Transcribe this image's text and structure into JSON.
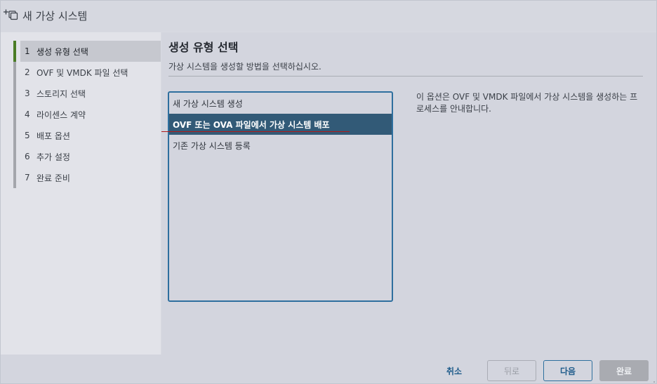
{
  "window": {
    "title": "새 가상 시스템",
    "icon": "new-vm-icon"
  },
  "nav": {
    "items": [
      {
        "num": "1",
        "label": "생성 유형 선택",
        "active": true
      },
      {
        "num": "2",
        "label": "OVF 및 VMDK 파일 선택",
        "active": false
      },
      {
        "num": "3",
        "label": "스토리지 선택",
        "active": false
      },
      {
        "num": "4",
        "label": "라이센스 계약",
        "active": false
      },
      {
        "num": "5",
        "label": "배포 옵션",
        "active": false
      },
      {
        "num": "6",
        "label": "추가 설정",
        "active": false
      },
      {
        "num": "7",
        "label": "완료 준비",
        "active": false
      }
    ]
  },
  "main": {
    "title": "생성 유형 선택",
    "subtitle": "가상 시스템을 생성할 방법을 선택하십시오.",
    "options": [
      {
        "label": "새 가상 시스템 생성",
        "selected": false
      },
      {
        "label": "OVF 또는 OVA 파일에서 가상 시스템 배포",
        "selected": true
      },
      {
        "label": "기존 가상 시스템 등록",
        "selected": false
      }
    ],
    "description": "이 옵션은 OVF 및 VMDK 파일에서 가상 시스템을 생성하는 프로세스를 안내합니다."
  },
  "footer": {
    "cancel": "취소",
    "back": "뒤로",
    "next": "다음",
    "finish": "완료"
  },
  "colors": {
    "accent": "#2e6f9e",
    "selected_row": "#325a77",
    "active_step": "#4a7c25"
  }
}
